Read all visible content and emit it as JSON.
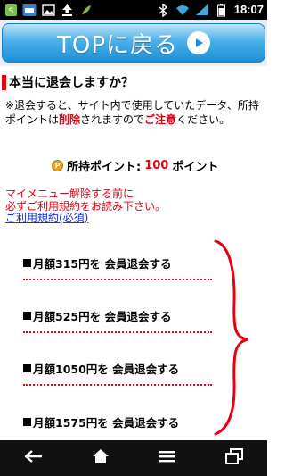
{
  "status_bar": {
    "time": "18:07",
    "left_icons": [
      "app-notification-icon",
      "ntt-badge-icon",
      "image-icon",
      "upload-icon",
      "feather-icon"
    ],
    "right_icons": [
      "bluetooth-icon",
      "wifi-icon",
      "signal-icon",
      "battery-icon"
    ]
  },
  "top_button": {
    "label": "TOPに戻る"
  },
  "heading": "本当に退会しますか？",
  "notice": {
    "part1": "※退会すると、サイト内で使用していたデータ、所持ポイントは",
    "emphasis1": "削除",
    "part2": "されますので",
    "emphasis2": "ご注意",
    "part3": "ください。"
  },
  "points": {
    "icon_text": "P",
    "label": "所持ポイント:",
    "value": "100",
    "unit": "ポイント"
  },
  "warning": {
    "line1": "マイメニュー解除する前に",
    "line2": "必ずご利用規約をお読み下さい。"
  },
  "terms_link": "ご利用規約(必須)",
  "plans": [
    "月額315円を 会員退会する",
    "月額525円を 会員退会する",
    "月額1050円を 会員退会する",
    "月額1575円を 会員退会する"
  ],
  "colors": {
    "accent_red": "#e60012",
    "link_blue": "#1a33cc",
    "button_blue": "#1c8fd8"
  }
}
